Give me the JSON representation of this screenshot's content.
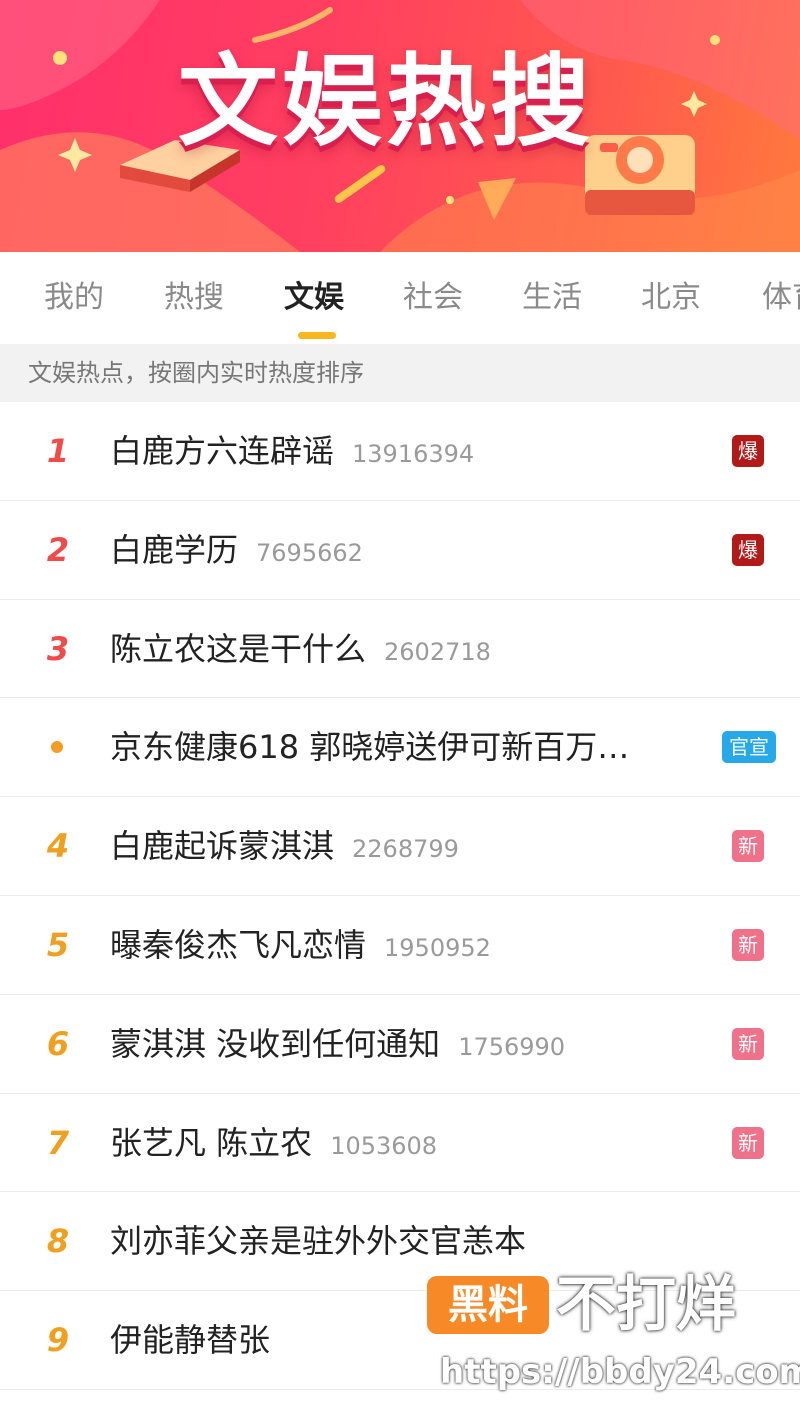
{
  "banner": {
    "title": "文娱热搜"
  },
  "tabs": [
    {
      "label": "我的",
      "active": false
    },
    {
      "label": "热搜",
      "active": false
    },
    {
      "label": "文娱",
      "active": true
    },
    {
      "label": "社会",
      "active": false
    },
    {
      "label": "生活",
      "active": false
    },
    {
      "label": "北京",
      "active": false
    },
    {
      "label": "体育",
      "active": false
    }
  ],
  "subtitle": "文娱热点，按圈内实时热度排序",
  "list": [
    {
      "rank": "1",
      "title": "白鹿方六连辟谣",
      "count": "13916394",
      "badge": "爆"
    },
    {
      "rank": "2",
      "title": "白鹿学历",
      "count": "7695662",
      "badge": "爆"
    },
    {
      "rank": "3",
      "title": "陈立农这是干什么",
      "count": "2602718",
      "badge": ""
    },
    {
      "rank": "",
      "title": "京东健康618 郭晓婷送伊可新百万…",
      "count": "",
      "badge": "官宣"
    },
    {
      "rank": "4",
      "title": "白鹿起诉蒙淇淇",
      "count": "2268799",
      "badge": "新"
    },
    {
      "rank": "5",
      "title": "曝秦俊杰飞凡恋情",
      "count": "1950952",
      "badge": "新"
    },
    {
      "rank": "6",
      "title": "蒙淇淇 没收到任何通知",
      "count": "1756990",
      "badge": "新"
    },
    {
      "rank": "7",
      "title": "张艺凡 陈立农",
      "count": "1053608",
      "badge": "新"
    },
    {
      "rank": "8",
      "title": "刘亦菲父亲是驻外外交官恙本",
      "count": "",
      "badge": ""
    },
    {
      "rank": "9",
      "title": "伊能静替张",
      "count": "",
      "badge": ""
    }
  ],
  "watermark": {
    "box_text": "黑料",
    "text": "不打烊",
    "url": "https://bbdy24.com"
  },
  "colors": {
    "banner_primary": "#ff3f60",
    "rank_top": "#f04b4b",
    "rank_other": "#f0a020",
    "tab_underline": "#f6b81c",
    "badge_bao": "#b21a1a",
    "badge_xin": "#f0728a",
    "badge_guan": "#27a8e8"
  }
}
